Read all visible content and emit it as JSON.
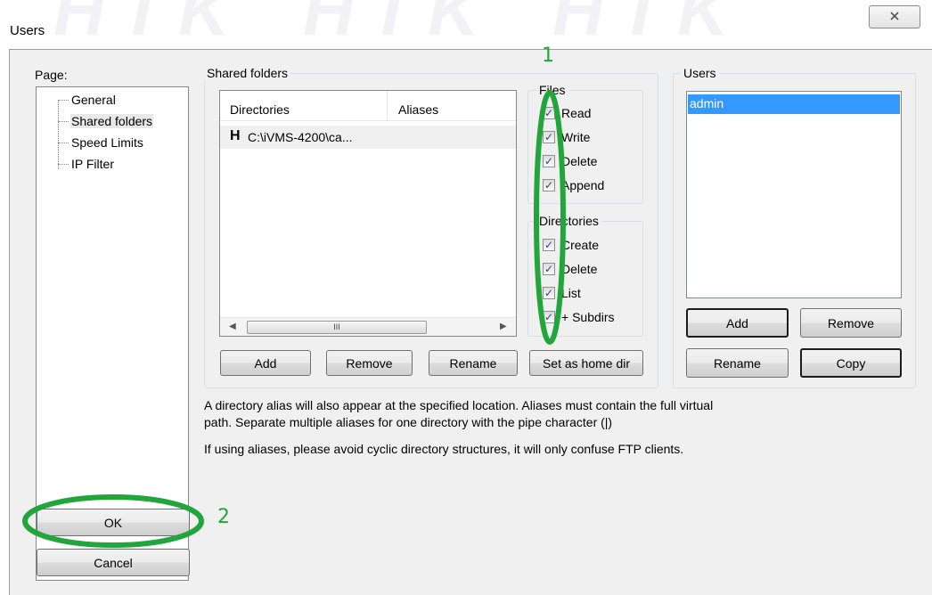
{
  "window": {
    "title": "Users",
    "close_symbol": "✕"
  },
  "page_panel": {
    "label": "Page:",
    "items": [
      {
        "label": "General"
      },
      {
        "label": "Shared folders"
      },
      {
        "label": "Speed Limits"
      },
      {
        "label": "IP Filter"
      }
    ]
  },
  "shared_folders": {
    "label": "Shared folders",
    "columns": [
      "Directories",
      "Aliases"
    ],
    "rows": [
      {
        "flag": "H",
        "path": "C:\\iVMS-4200\\ca..."
      }
    ],
    "scroll_thumb_grip": "III",
    "buttons": {
      "add": "Add",
      "remove": "Remove",
      "rename": "Rename",
      "set_home": "Set as home dir"
    }
  },
  "files": {
    "label": "Files",
    "options": [
      {
        "label": "Read",
        "checked": true
      },
      {
        "label": "Write",
        "checked": true
      },
      {
        "label": "Delete",
        "checked": true
      },
      {
        "label": "Append",
        "checked": true
      }
    ]
  },
  "directories": {
    "label": "Directories",
    "options": [
      {
        "label": "Create",
        "checked": true
      },
      {
        "label": "Delete",
        "checked": true
      },
      {
        "label": "List",
        "checked": true
      },
      {
        "label": "+ Subdirs",
        "checked": true
      }
    ]
  },
  "users": {
    "label": "Users",
    "list": [
      "admin"
    ],
    "buttons": {
      "add": "Add",
      "remove": "Remove",
      "rename": "Rename",
      "copy": "Copy"
    }
  },
  "descriptions": {
    "line1": "A directory alias will also appear at the specified location. Aliases must contain the full virtual",
    "line2": "path. Separate multiple aliases for one directory with the pipe character (|)",
    "line3": "If using aliases, please avoid cyclic directory structures, it will only confuse FTP clients."
  },
  "dialog_buttons": {
    "ok": "OK",
    "cancel": "Cancel"
  },
  "annotations": {
    "marker1": "1",
    "marker2": "2",
    "color": "#22a53a"
  },
  "colors": {
    "selection": "#3399ff",
    "window_bg": "#f0f0f0"
  }
}
